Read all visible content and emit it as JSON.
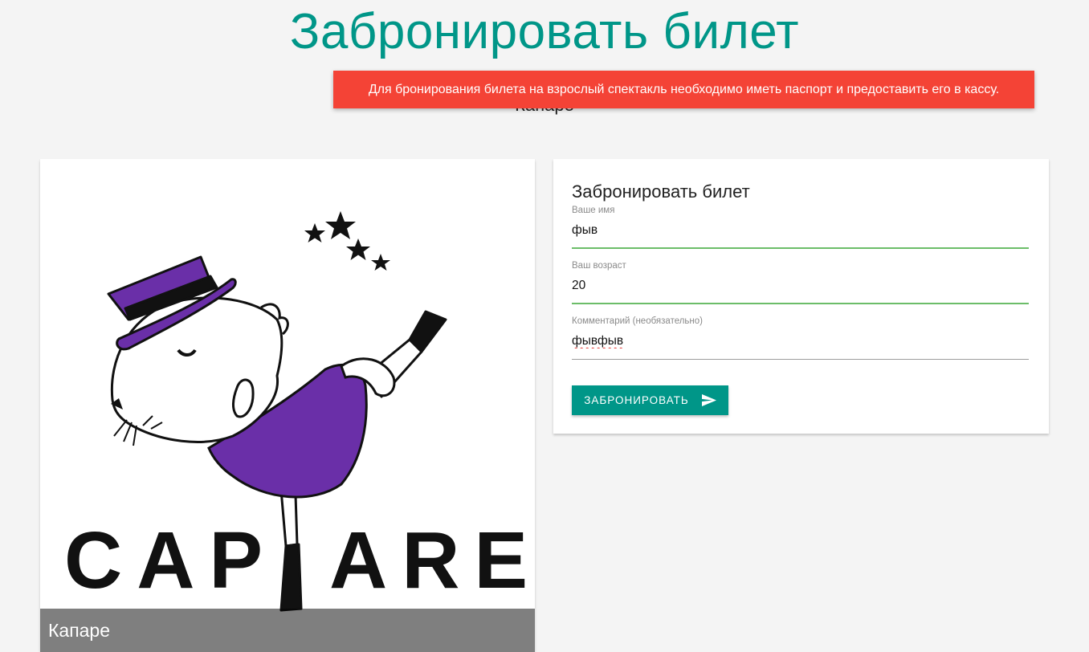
{
  "header": {
    "title": "Забронировать билет",
    "subtitle": "Капаре"
  },
  "toast": {
    "message": "Для бронирования билета на взрослый спектакль необходимо иметь паспорт и предоставить его в кассу.",
    "color": "#f44336"
  },
  "show": {
    "logo_text": "CAPARE",
    "caption": "Капаре",
    "accent_color": "#6a2fa8"
  },
  "form": {
    "title": "Забронировать билет",
    "fields": [
      {
        "label": "Ваше имя",
        "value": "фыв"
      },
      {
        "label": "Ваш возраст",
        "value": "20"
      },
      {
        "label": "Комментарий (необязательно)",
        "value": "фывфыв"
      }
    ],
    "submit_label": "ЗАБРОНИРОВАТЬ",
    "submit_icon": "send-icon",
    "primary_color": "#009688",
    "valid_color": "#6cbd69"
  }
}
